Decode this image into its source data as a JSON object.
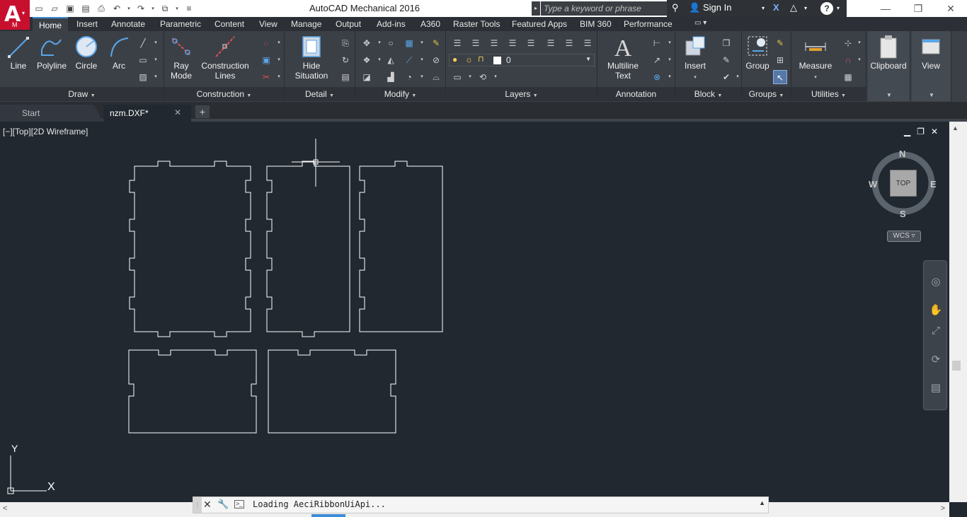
{
  "app": {
    "title": "AutoCAD Mechanical 2016",
    "logo_letter": "A",
    "logo_sub": "M",
    "search_placeholder": "Type a keyword or phrase",
    "sign_in": "Sign In"
  },
  "ribbon_tabs": [
    "Home",
    "Insert",
    "Annotate",
    "Parametric",
    "Content",
    "View",
    "Manage",
    "Output",
    "Add-ins",
    "A360",
    "Raster Tools",
    "Featured Apps",
    "BIM 360",
    "Performance"
  ],
  "panels": {
    "draw": {
      "title": "Draw",
      "tools": [
        "Line",
        "Polyline",
        "Circle",
        "Arc"
      ]
    },
    "construction": {
      "title": "Construction",
      "ray": "Ray",
      "ray2": "Mode",
      "cl": "Construction",
      "cl2": "Lines"
    },
    "detail": {
      "title": "Detail",
      "hide": "Hide",
      "hide2": "Situation"
    },
    "modify": {
      "title": "Modify"
    },
    "layers": {
      "title": "Layers",
      "current_layer": "0"
    },
    "annotation": {
      "title": "Annotation",
      "mtext": "Multiline",
      "mtext2": "Text"
    },
    "block": {
      "title": "Block",
      "insert": "Insert"
    },
    "groups": {
      "title": "Groups",
      "group": "Group"
    },
    "utilities": {
      "title": "Utilities",
      "measure": "Measure"
    },
    "clipboard": {
      "title": "Clipboard"
    },
    "view": {
      "title": "View"
    }
  },
  "doc_tabs": {
    "start": "Start",
    "file": "nzm.DXF*",
    "add": "+"
  },
  "viewport": {
    "label": "[−][Top][2D Wireframe]",
    "compass": {
      "n": "N",
      "s": "S",
      "e": "E",
      "w": "W",
      "face": "TOP"
    },
    "wcs": "WCS",
    "ucs": {
      "x": "X",
      "y": "Y"
    }
  },
  "command_line": {
    "text": "Loading AeciRibbonUiApi..."
  }
}
